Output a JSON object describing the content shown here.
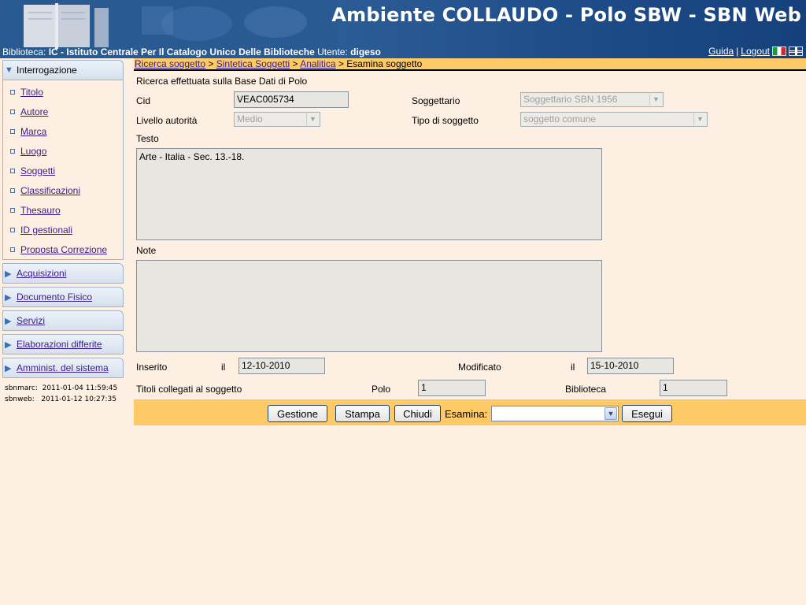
{
  "header": {
    "title": "Ambiente COLLAUDO - Polo SBW - SBN Web",
    "biblioteca_label": "Biblioteca:",
    "biblioteca_value": "IC - Istituto Centrale Per Il Catalogo Unico Delle Biblioteche",
    "utente_label": "Utente:",
    "utente_value": "digeso",
    "links": {
      "guida": "Guida",
      "separator": "|",
      "logout": "Logout"
    },
    "flags": [
      "italian-flag-icon",
      "uk-flag-icon"
    ]
  },
  "sidebar": {
    "open_section": "Interrogazione",
    "items": [
      "Titolo",
      "Autore",
      "Marca",
      "Luogo",
      "Soggetti",
      "Classificazioni",
      "Thesauro",
      "ID gestionali",
      "Proposta Correzione"
    ],
    "sections": [
      "Acquisizioni",
      "Documento Fisico",
      "Servizi",
      "Elaborazioni differite",
      "Amminist. del sistema"
    ],
    "timestamps": [
      "sbnmarc:  2011-01-04 11:59:45",
      "sbnweb:   2011-01-12 10:27:35"
    ]
  },
  "breadcrumb": {
    "links": [
      "Ricerca soggetto",
      "Sintetica Soggetti",
      "Analitica"
    ],
    "separator": ">",
    "current": "Esamina soggetto"
  },
  "form": {
    "info": "Ricerca effettuata sulla Base Dati di Polo",
    "cid_label": "Cid",
    "cid_value": "VEAC005734",
    "soggettario_label": "Soggettario",
    "soggettario_value": "Soggettario SBN 1956",
    "livello_label": "Livello autorità",
    "livello_value": "Medio",
    "tipo_label": "Tipo di soggetto",
    "tipo_value": "soggetto comune",
    "testo_label": "Testo",
    "testo_value": "Arte - Italia - Sec. 13.-18.",
    "note_label": "Note",
    "note_value": "",
    "inserito_label": "Inserito",
    "il_label": "il",
    "inserito_value": "12-10-2010",
    "modificato_label": "Modificato",
    "modificato_value": "15-10-2010",
    "titoli_label": "Titoli collegati al soggetto",
    "polo_label": "Polo",
    "polo_value": "1",
    "biblioteca_label": "Biblioteca",
    "biblioteca_value": "1"
  },
  "actions": {
    "gestione": "Gestione",
    "stampa": "Stampa",
    "chiudi": "Chiudi",
    "esamina_label": "Esamina:",
    "esamina_value": "",
    "esegui": "Esegui"
  },
  "colors": {
    "header_blue": "#234e86",
    "page_bg": "#fdefe2",
    "accent_orange": "#fdca67",
    "link_purple": "#3a1d8a"
  }
}
